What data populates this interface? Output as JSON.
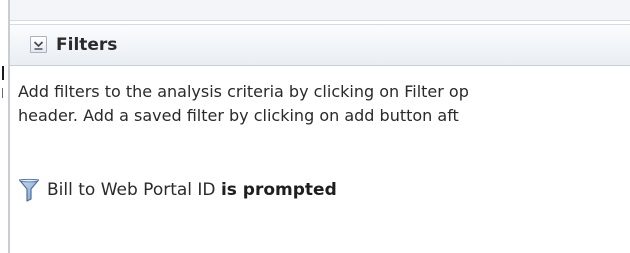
{
  "filters_panel": {
    "title": "Filters",
    "description_line1": "Add filters to the analysis criteria by clicking on Filter op",
    "description_line2": "header. Add a saved filter by clicking on add button aft",
    "filter": {
      "column": "Bill to Web Portal ID ",
      "operator": "is prompted",
      "icon": "funnel-icon"
    },
    "collapse_icon": "chevron-down-icon"
  },
  "colors": {
    "header_bg": "#e9eef3",
    "border": "#c7ced6",
    "funnel_fill": "#8fb0d8",
    "funnel_stroke": "#4f6f97"
  }
}
